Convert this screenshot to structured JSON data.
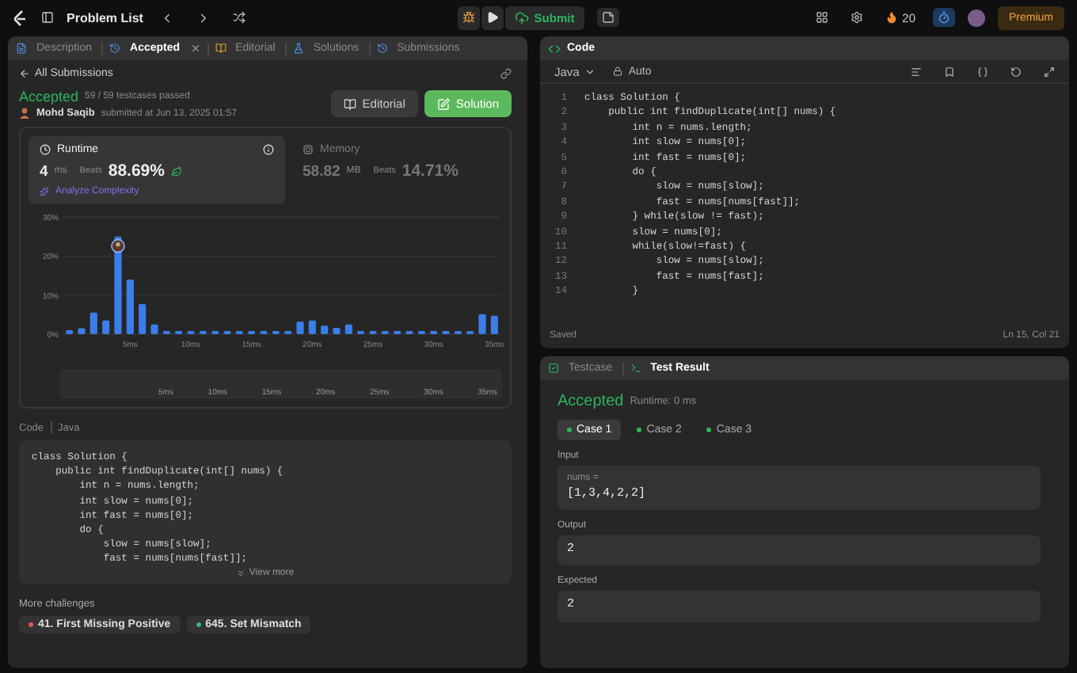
{
  "top_bar": {
    "title": "Problem List",
    "submit": "Submit",
    "streak": "20",
    "premium": "Premium"
  },
  "left_tabs": [
    {
      "label": "Description",
      "selected": false,
      "closable": false
    },
    {
      "label": "Accepted",
      "selected": true,
      "closable": true
    },
    {
      "label": "Editorial",
      "selected": false,
      "closable": false
    },
    {
      "label": "Solutions",
      "selected": false,
      "closable": false
    },
    {
      "label": "Submissions",
      "selected": false,
      "closable": false
    }
  ],
  "back_link": "All Submissions",
  "result": {
    "status": "Accepted",
    "passed": "59 / 59 testcases passed",
    "user": "Mohd Saqib",
    "submitted": "submitted at Jun 13, 2025 01:57"
  },
  "actions": [
    {
      "label": "Editorial",
      "kind": "secondary"
    },
    {
      "label": "Solution",
      "kind": "primary"
    }
  ],
  "stats": [
    {
      "kind": "runtime",
      "title": "Runtime",
      "value": "4",
      "unit": "ms",
      "beats_label": "Beats",
      "beats": "88.69%",
      "extra": "Analyze Complexity",
      "selected": true
    },
    {
      "kind": "memory",
      "title": "Memory",
      "value": "58.82",
      "unit": "MB",
      "beats_label": "Beats",
      "beats": "14.71%",
      "selected": false
    }
  ],
  "chart_data": {
    "type": "bar",
    "x": [
      0,
      1,
      2,
      3,
      4,
      5,
      6,
      7,
      8,
      9,
      10,
      11,
      12,
      13,
      14,
      15,
      16,
      17,
      18,
      19,
      20,
      21,
      22,
      23,
      24,
      25,
      26,
      27,
      28,
      29,
      30,
      31,
      32,
      33,
      34,
      35
    ],
    "xlim": [
      -0.5,
      35.5
    ],
    "series": [
      {
        "color": "#3b7de9",
        "values": [
          1,
          1.5,
          5.5,
          3.5,
          25,
          14,
          7.7,
          2.5,
          0.8,
          0.8,
          0.8,
          0.8,
          0.8,
          0.8,
          0.8,
          0.8,
          0.8,
          0.8,
          0.8,
          3.2,
          3.5,
          2.2,
          1.6,
          2.5,
          0.8,
          0.8,
          0.8,
          0.8,
          0.8,
          0.8,
          0.8,
          0.8,
          0.8,
          0.8,
          5.1,
          4.7
        ]
      }
    ],
    "xticks": [
      {
        "value": 5,
        "label": "5ms"
      },
      {
        "value": 10,
        "label": "10ms"
      },
      {
        "value": 15,
        "label": "15ms"
      },
      {
        "value": 20,
        "label": "20ms"
      },
      {
        "value": 25,
        "label": "25ms"
      },
      {
        "value": 30,
        "label": "30ms"
      },
      {
        "value": 35,
        "label": "35ms"
      }
    ],
    "yticks": [
      {
        "value": 0,
        "label": "0%"
      },
      {
        "value": 10,
        "label": "10%"
      },
      {
        "value": 20,
        "label": "20%"
      },
      {
        "value": 30,
        "label": "30%"
      }
    ],
    "ylim": [
      0,
      30
    ]
  },
  "overview_labels": [
    "5ms",
    "10ms",
    "15ms",
    "20ms",
    "25ms",
    "30ms",
    "35ms"
  ],
  "code_preview": {
    "label": "Code",
    "language": "Java",
    "lines": [
      "class Solution {",
      "    public int findDuplicate(int[] nums) {",
      "        int n = nums.length;",
      "        int slow = nums[0];",
      "        int fast = nums[0];",
      "        do {",
      "            slow = nums[slow];",
      "            fast = nums[nums[fast]];"
    ],
    "more": "View more"
  },
  "more_challenges": {
    "title": "More challenges",
    "items": [
      {
        "label": "41. First Missing Positive",
        "color": "#e05454"
      },
      {
        "label": "645. Set Mismatch",
        "color": "#2fb88a"
      }
    ]
  },
  "editor": {
    "title": "Code",
    "language": "Java",
    "mode": "Auto",
    "lines": [
      {
        "number": "1",
        "text": "class Solution {"
      },
      {
        "number": "2",
        "text": "    public int findDuplicate(int[] nums) {"
      },
      {
        "number": "3",
        "text": "        int n = nums.length;"
      },
      {
        "number": "4",
        "text": "        int slow = nums[0];"
      },
      {
        "number": "5",
        "text": "        int fast = nums[0];"
      },
      {
        "number": "6",
        "text": "        do {"
      },
      {
        "number": "7",
        "text": "            slow = nums[slow];"
      },
      {
        "number": "8",
        "text": "            fast = nums[nums[fast]];"
      },
      {
        "number": "9",
        "text": "        } while(slow != fast);"
      },
      {
        "number": "10",
        "text": "        slow = nums[0];"
      },
      {
        "number": "11",
        "text": "        while(slow!=fast) {"
      },
      {
        "number": "12",
        "text": "            slow = nums[slow];"
      },
      {
        "number": "13",
        "text": "            fast = nums[fast];"
      },
      {
        "number": "14",
        "text": "        }"
      }
    ],
    "status": "Saved",
    "cursor": "Ln 15, Col 21"
  },
  "result_panel": {
    "tabs": [
      {
        "label": "Testcase",
        "selected": false
      },
      {
        "label": "Test Result",
        "selected": true
      }
    ],
    "status": "Accepted",
    "runtime": "Runtime: 0 ms",
    "cases": [
      {
        "label": "Case 1",
        "selected": true
      },
      {
        "label": "Case 2",
        "selected": false
      },
      {
        "label": "Case 3",
        "selected": false
      }
    ],
    "sections": [
      {
        "label": "Input",
        "name": "nums =",
        "value": "[1,3,4,2,2]"
      },
      {
        "label": "Output",
        "value": "2"
      },
      {
        "label": "Expected",
        "value": "2"
      }
    ]
  }
}
